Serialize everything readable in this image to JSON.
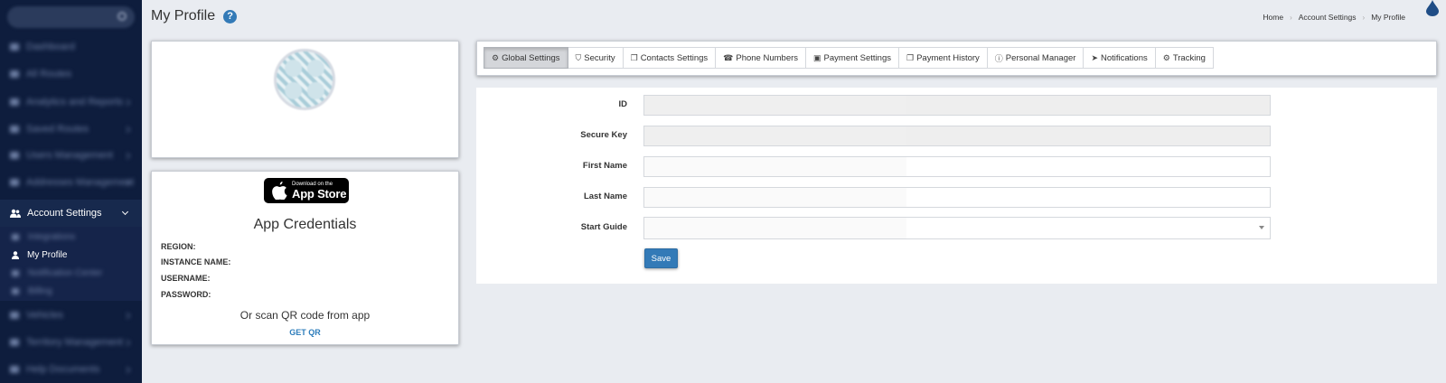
{
  "header": {
    "title": "My Profile",
    "help_glyph": "?",
    "breadcrumb": [
      "Home",
      "Account Settings",
      "My Profile"
    ]
  },
  "sidebar": {
    "active_section": "Account Settings",
    "active_page": "My Profile"
  },
  "profile": {
    "name": "",
    "subtitle": ""
  },
  "credentials": {
    "appstore_small": "Download on the",
    "appstore_big": "App Store",
    "title": "App Credentials",
    "rows": [
      {
        "label": "REGION:",
        "value": ""
      },
      {
        "label": "INSTANCE NAME:",
        "value": ""
      },
      {
        "label": "USERNAME:",
        "value": ""
      },
      {
        "label": "PASSWORD:",
        "value": ""
      }
    ],
    "qr_text": "Or scan QR code from app",
    "get_qr": "GET QR"
  },
  "tabs": [
    {
      "label": "Global Settings",
      "icon": "gears-icon",
      "active": true
    },
    {
      "label": "Security",
      "icon": "shield-icon"
    },
    {
      "label": "Contacts Settings",
      "icon": "copy-icon"
    },
    {
      "label": "Phone Numbers",
      "icon": "phone-icon"
    },
    {
      "label": "Payment Settings",
      "icon": "money-icon"
    },
    {
      "label": "Payment History",
      "icon": "copy-icon"
    },
    {
      "label": "Personal Manager",
      "icon": "info-icon"
    },
    {
      "label": "Notifications",
      "icon": "location-arrow-icon"
    },
    {
      "label": "Tracking",
      "icon": "gears-icon"
    }
  ],
  "form": {
    "fields": [
      {
        "label": "ID",
        "value": "",
        "readonly": true
      },
      {
        "label": "Secure Key",
        "value": "",
        "readonly": true
      },
      {
        "label": "First Name",
        "value": "",
        "readonly": false
      },
      {
        "label": "Last Name",
        "value": "",
        "readonly": false
      },
      {
        "label": "Start Guide",
        "value": "",
        "readonly": false,
        "type": "select"
      }
    ],
    "save_label": "Save"
  },
  "colors": {
    "sidebar_bg": "#0e1d3d",
    "accent": "#337ab7",
    "page_bg": "#e9ecf1"
  }
}
